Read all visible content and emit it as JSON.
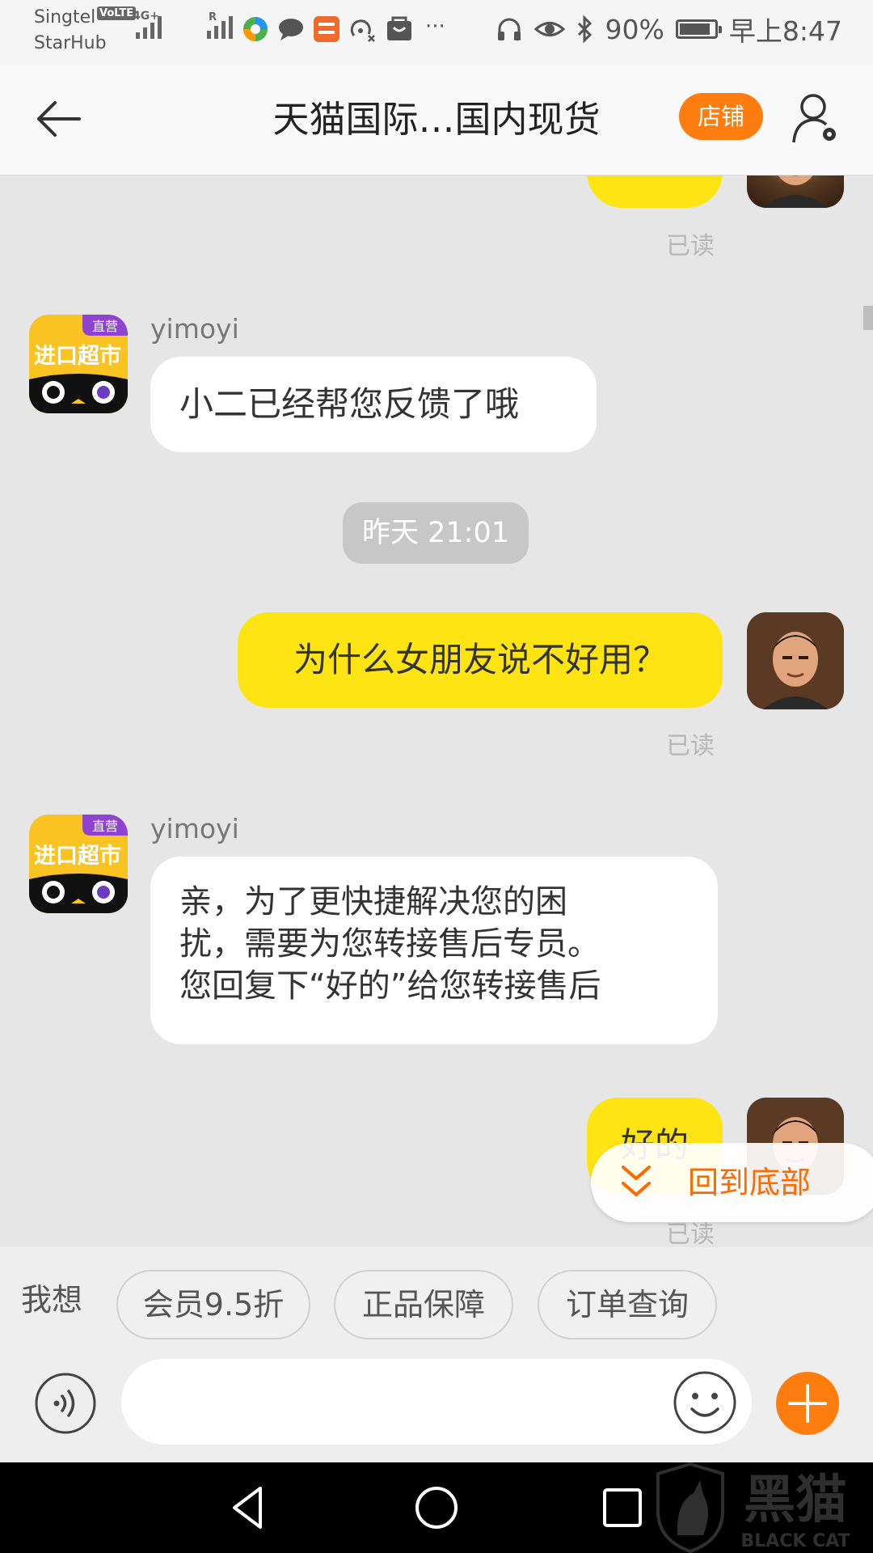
{
  "status_bar": {
    "carrier_1": "Singtel",
    "carrier_2": "StarHub",
    "volte": "VoLTE",
    "network": "4G+",
    "roaming": "R",
    "battery_percent": "90%",
    "battery_level": 0.9,
    "time": "早上8:47",
    "more": "···"
  },
  "nav": {
    "title": "天猫国际…国内现货",
    "shop_button": "店铺"
  },
  "chat": {
    "messages": [
      {
        "side": "out",
        "text": "",
        "read_label": "已读"
      },
      {
        "side": "in",
        "sender": "yimoyi",
        "text": "小二已经帮您反馈了哦"
      },
      {
        "timestamp": "昨天  21:01"
      },
      {
        "side": "out",
        "text": "为什么女朋友说不好用？",
        "read_label": "已读"
      },
      {
        "side": "in",
        "sender": "yimoyi",
        "text": "亲，为了更快捷解决您的困\n扰，需要为您转接售后专员。\n您回复下“好的”给您转接售后"
      },
      {
        "side": "out",
        "text": "好的",
        "read_label": "已读"
      }
    ],
    "shop_avatar": {
      "badge": "直营",
      "text": "进口超市"
    },
    "back_to_bottom": "回到底部"
  },
  "quick_replies": {
    "label": "我想",
    "chips": [
      "会员9.5折",
      "正品保障",
      "订单查询"
    ]
  },
  "input": {
    "placeholder": ""
  },
  "watermark": {
    "cn": "黑猫",
    "en": "BLACK CAT"
  },
  "colors": {
    "accent": "#ff7d0f",
    "outgoing_bubble": "#ffe414",
    "incoming_bubble": "#ffffff",
    "chat_background": "#e6e6e6",
    "link_orange": "#ff6a00"
  }
}
